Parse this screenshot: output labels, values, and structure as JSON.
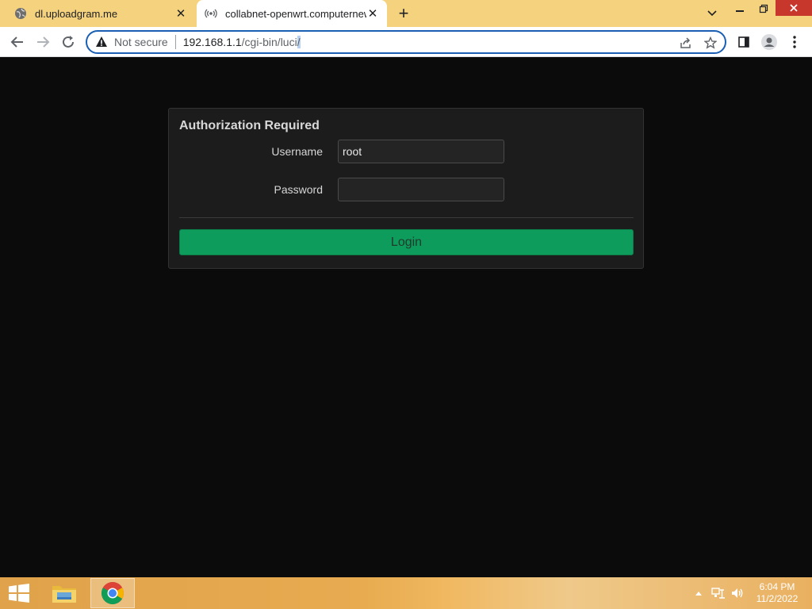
{
  "browser": {
    "tabs": [
      {
        "title": "dl.uploadgram.me",
        "icon": "globe-icon",
        "active": false
      },
      {
        "title": "collabnet-openwrt.computernew",
        "icon": "wireless-broadcast-icon",
        "active": true
      }
    ],
    "address_bar": {
      "security_label": "Not secure",
      "url_host": "192.168.1.1",
      "url_path": "/cgi-bin/luci",
      "url_selected": "/"
    },
    "colors": {
      "tabstrip": "#f4d27e",
      "omnibox_focus": "#1a5fb4"
    }
  },
  "login": {
    "title": "Authorization Required",
    "username_label": "Username",
    "username_value": "root",
    "password_label": "Password",
    "password_value": "",
    "login_button": "Login",
    "colors": {
      "button": "#0e9c5c",
      "card": "#1c1c1c",
      "page": "#0b0b0b"
    }
  },
  "taskbar": {
    "apps": [
      "file-explorer-icon",
      "chrome-icon"
    ],
    "clock_time": "6:04 PM",
    "clock_date": "11/2/2022"
  }
}
